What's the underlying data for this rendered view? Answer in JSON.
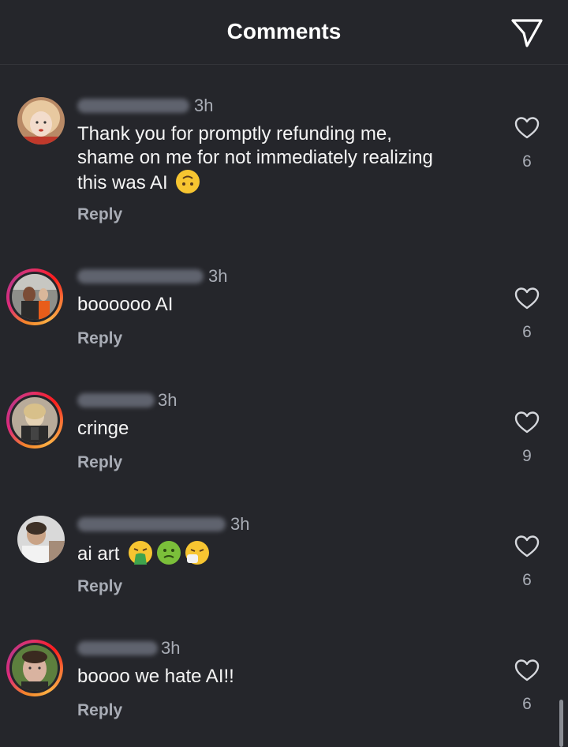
{
  "header": {
    "title": "Comments",
    "share_icon": "paper-plane-icon"
  },
  "comments": [
    {
      "time": "3h",
      "text": "Thank you for promptly refunding me,\nshame on me for not immediately realizing\nthis was AI",
      "emojis": [
        "upside-down-face-emoji"
      ],
      "reply": "Reply",
      "likes": "6"
    },
    {
      "time": "3h",
      "text": "boooooo AI",
      "emojis": [],
      "reply": "Reply",
      "likes": "6"
    },
    {
      "time": "3h",
      "text": "cringe",
      "emojis": [],
      "reply": "Reply",
      "likes": "9"
    },
    {
      "time": "3h",
      "text": "ai art",
      "emojis": [
        "vomiting-face-emoji",
        "nauseated-face-emoji",
        "sneezing-face-emoji"
      ],
      "reply": "Reply",
      "likes": "6"
    },
    {
      "time": "3h",
      "text": "boooo we hate AI!!",
      "emojis": [],
      "reply": "Reply",
      "likes": "6"
    }
  ],
  "colors": {
    "background": "#25262b",
    "text": "#f5f5f5",
    "muted": "#a8acb5",
    "story_ring_start": "#f58529",
    "story_ring_end": "#dd2a7b"
  }
}
